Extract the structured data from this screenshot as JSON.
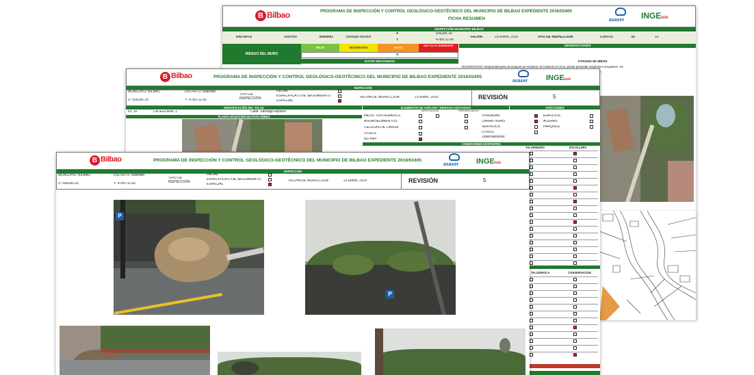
{
  "brand": {
    "city": "Bilbao",
    "logo_letter": "B",
    "partner_a": "asaser",
    "partner_b": "INGE",
    "partner_b_suffix": "luis"
  },
  "sheet_back": {
    "title": "PROGRAMA DE INSPECCIÓN Y CONTROL GEOLÓGICO-GEOTÉCNICO DEL MUNICIPIO DE BILBAO EXPEDIENTE 2016/02405",
    "subtitle": "FICHA RESUMEN",
    "band": "INSPECCIÓN MUNICIPIO BILBAO",
    "row_labels": [
      "DISTRITO",
      "Ibaiondo",
      "BARRIO",
      "Santiago Apóstol",
      "FECHA",
      "23 Enero, 2019",
      "TIPO DE INSPECCIÓN",
      "Especial",
      "ID",
      "16"
    ],
    "coords": [
      "506285.18",
      "4789711.60"
    ],
    "coord_keys": [
      "X",
      "Y"
    ],
    "risk_label": "RIESGO DEL MURO",
    "risk_levels": [
      "BAJO",
      "MODERADO",
      "ALTO",
      "MUY ALTO INMINENTE"
    ],
    "risk_value": "X",
    "data_band": "DATOS RECOGIDOS",
    "obs_label": "OBSERVACIONES",
    "obs_heading": "Proceso de aterro",
    "obs_line1": "DIAGNÓSTICO: Desprendimiento de bloques de escollera. El contexto es seco, puede presentar desplomes irregulares. Se",
    "obs_line2": "retira. Se recomienda control y seguimiento."
  },
  "sheet_mid": {
    "title": "PROGRAMA DE INSPECCIÓN Y CONTROL GEOLÓGICO-GEOTÉCNICO DEL MUNICIPIO DE BILBAO EXPEDIENTE 2016/02405",
    "band": "INSPECCIÓN",
    "mun_label": "MUNICIPIO: BILBAO",
    "dist_label": "DISTRITO: Ibaiondo",
    "x_label": "X: 506285.18",
    "y_label": "Y: 4789711.60",
    "tipo_label": "TIPO DE INSPECCIÓN:",
    "opt_inicial": "INICIAL",
    "opt_esp": "ESPECÍFICA O DE SEGUIMIENTO",
    "opt_especial": "ESPECIAL",
    "fecha_label": "FECHA DE INSPECCIÓN:",
    "fecha_val": "23 Enero, 2019",
    "rev_label": "REVISIÓN",
    "rev_val": "5",
    "ident_band": "IDENTIFICACIÓN DEL TALUD",
    "id_label": "ID: 16",
    "cat_label": "CATEGORÍA: 1",
    "calle_label": "Calle: Santiago Apóstol",
    "aerial_band": "PLANTA SITUACIÓN EN FOTO AÉREA",
    "elem_band": "ELEMENTOS DE ANÁLISIS / RIESGOS ASOCIADOS",
    "elem_cols": [
      "AFECTACIÓN",
      "PRESENTADOS"
    ],
    "elems": [
      "INICIO TOPOGRÁFICO",
      "AGUA/SEDIMENTOS",
      "CÉLULAS DE CARGA",
      "OTROS",
      "NO HAY"
    ],
    "acc_band": "AFECCIONES",
    "acc_left": [
      "VIVIENDAS",
      "CARRETERAS",
      "SERVICIOS",
      "OTROS"
    ],
    "acc_right": [
      "EDIFICIOS",
      "ACERAS",
      "PARQUES"
    ],
    "acc_note": "Observaciones:",
    "cond_band": "CONDICIONES EXISTENTES",
    "col_labels": [
      "TALUD/MURO",
      "ESCOLLERA"
    ],
    "col_labels2": [
      "TALUD/ROCA",
      "CONSERVACIÓN"
    ]
  },
  "sheet_front": {
    "title": "PROGRAMA DE INSPECCIÓN Y CONTROL GEOLÓGICO-GEOTÉCNICO DEL MUNICIPIO DE BILBAO EXPEDIENTE 2016/02405",
    "band": "INSPECCIÓN",
    "mun_label": "MUNICIPIO: BILBAO",
    "dist_label": "DISTRITO: Ibaiondo",
    "x_label": "X: 506285.18",
    "y_label": "Y: 4789711.60",
    "tipo_label": "TIPO DE INSPECCIÓN:",
    "opt_inicial": "INICIAL",
    "opt_esp": "ESPECÍFICA O DE SEGUIMIENTO",
    "opt_especial": "ESPECIAL",
    "fecha_label": "FECHA DE INSPECCIÓN:",
    "fecha_val": "23 Enero, 2019",
    "rev_label": "REVISIÓN",
    "rev_val": "5"
  },
  "colors": {
    "green": "#1f7a2e",
    "red": "#d81e2a",
    "low": "#7cc242",
    "moderate": "#f2e500",
    "high": "#f7931e",
    "very_high": "#e31d1d"
  }
}
